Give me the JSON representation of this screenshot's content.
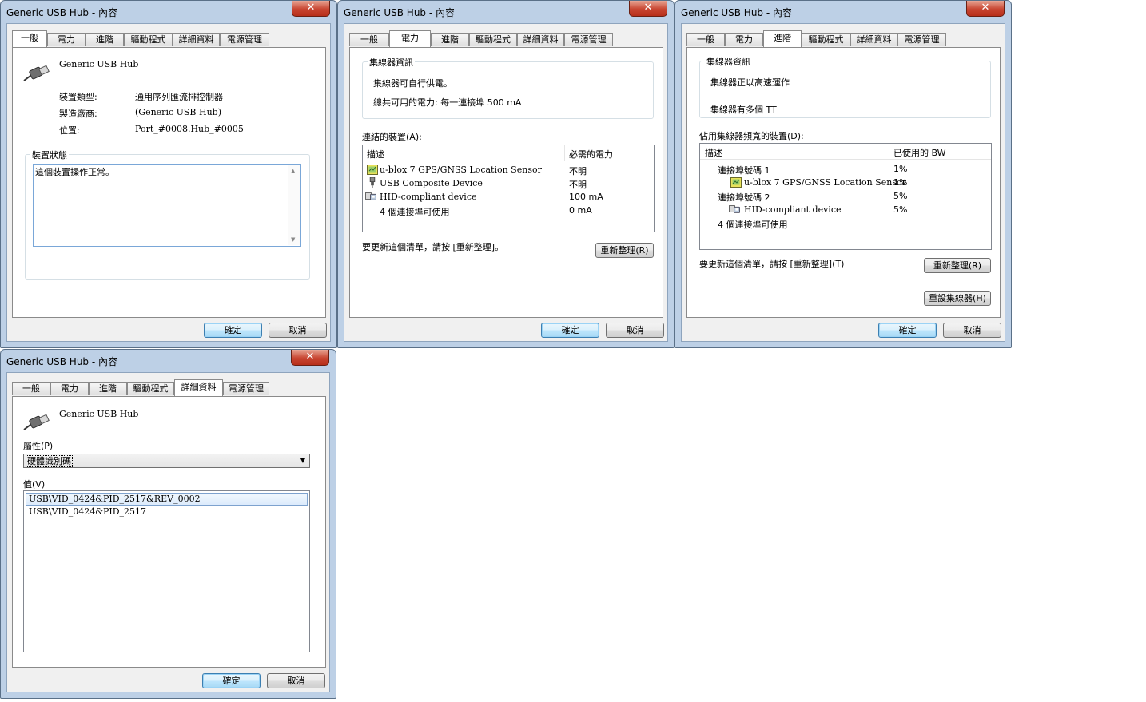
{
  "window_title": "Generic USB Hub - 內容",
  "close_glyph": "✕",
  "tabs": [
    "一般",
    "電力",
    "進階",
    "驅動程式",
    "詳細資料",
    "電源管理"
  ],
  "buttons": {
    "ok": "確定",
    "cancel": "取消"
  },
  "general": {
    "device_name": "Generic USB Hub",
    "fields": [
      {
        "label": "裝置類型:",
        "value": "通用序列匯流排控制器"
      },
      {
        "label": "製造廠商:",
        "value": "(Generic USB Hub)"
      },
      {
        "label": "位置:",
        "value": "Port_#0008.Hub_#0005"
      }
    ],
    "status_group": "裝置狀態",
    "status_text": "這個裝置操作正常。"
  },
  "power": {
    "hub_info_group": "集線器資訊",
    "line1": "集線器可自行供電。",
    "line2": "總共可用的電力: 每一連接埠 500 mA",
    "connected_label": "連結的裝置(A):",
    "col_desc": "描述",
    "col_power": "必需的電力",
    "rows": [
      {
        "icon": "gps-icon",
        "name": "u-blox 7 GPS/GNSS Location Sensor",
        "power": "不明"
      },
      {
        "icon": "usb-device-icon",
        "name": "USB Composite Device",
        "power": "不明"
      },
      {
        "icon": "hid-device-icon",
        "name": "HID-compliant device",
        "power": "100 mA"
      },
      {
        "icon": "",
        "name": "4 個連接埠可使用",
        "power": "0 mA"
      }
    ],
    "refresh_hint": "要更新這個清單，請按 [重新整理]。",
    "refresh_button": "重新整理(R)"
  },
  "advanced": {
    "hub_info_group": "集線器資訊",
    "line1": "集線器正以高速運作",
    "line2": "集線器有多個 TT",
    "bandwidth_label": "佔用集線器頻寬的裝置(D):",
    "col_desc": "描述",
    "col_bw": "已使用的 BW",
    "rows": [
      {
        "indent": 1,
        "icon": "",
        "name": "連接埠號碼 1",
        "bw": "1%"
      },
      {
        "indent": 2,
        "icon": "gps-icon",
        "name": "u-blox 7 GPS/GNSS Location Sensor",
        "bw": "1%"
      },
      {
        "indent": 1,
        "icon": "",
        "name": "連接埠號碼 2",
        "bw": "5%"
      },
      {
        "indent": 2,
        "icon": "hid-device-icon",
        "name": "HID-compliant device",
        "bw": "5%"
      },
      {
        "indent": 1,
        "icon": "",
        "name": "4 個連接埠可使用",
        "bw": ""
      }
    ],
    "refresh_hint": "要更新這個清單，請按 [重新整理](T)",
    "refresh_button": "重新整理(R)",
    "reset_button": "重設集線器(H)"
  },
  "details": {
    "device_name": "Generic USB Hub",
    "property_label": "屬性(P)",
    "property_selected": "硬體識別碼",
    "value_label": "值(V)",
    "values": [
      "USB\\VID_0424&PID_2517&REV_0002",
      "USB\\VID_0424&PID_2517"
    ]
  },
  "colors": {
    "accent": "#3c7fb1",
    "close": "#c84531",
    "frame": "#bdd0e6"
  }
}
